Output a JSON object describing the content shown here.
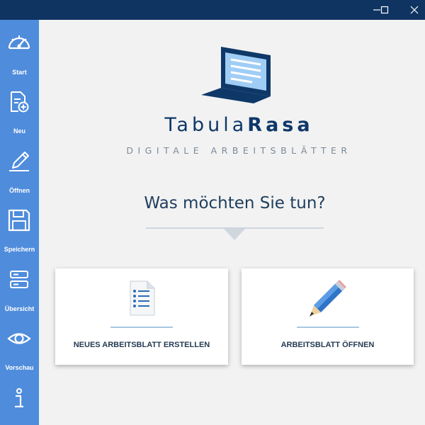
{
  "window": {
    "minimize_icon": "minimize-icon",
    "maximize_icon": "maximize-icon",
    "close_icon": "close-icon"
  },
  "sidebar": {
    "items": [
      {
        "label": "Start",
        "icon": "speedometer-icon"
      },
      {
        "label": "Neu",
        "icon": "new-document-icon"
      },
      {
        "label": "Öffnen",
        "icon": "pencil-icon"
      },
      {
        "label": "Speichern",
        "icon": "floppy-disk-icon"
      },
      {
        "label": "Übersicht",
        "icon": "overview-icon"
      },
      {
        "label": "Vorschau",
        "icon": "eye-icon"
      },
      {
        "label": "",
        "icon": "info-icon"
      }
    ]
  },
  "brand": {
    "name_regular": "Tabula",
    "name_bold": "Rasa",
    "tagline": "DIGITALE ARBEITSBLÄTTER"
  },
  "main": {
    "question": "Was möchten Sie tun?",
    "cards": [
      {
        "label": "NEUES ARBEITSBLATT ERSTELLEN",
        "icon": "document-list-icon"
      },
      {
        "label": "ARBEITSBLATT ÖFFNEN",
        "icon": "pencil-icon"
      }
    ]
  },
  "colors": {
    "titlebar": "#0f3461",
    "sidebar": "#4f8cdc",
    "background": "#f2f2f2",
    "brand": "#0e3868"
  }
}
